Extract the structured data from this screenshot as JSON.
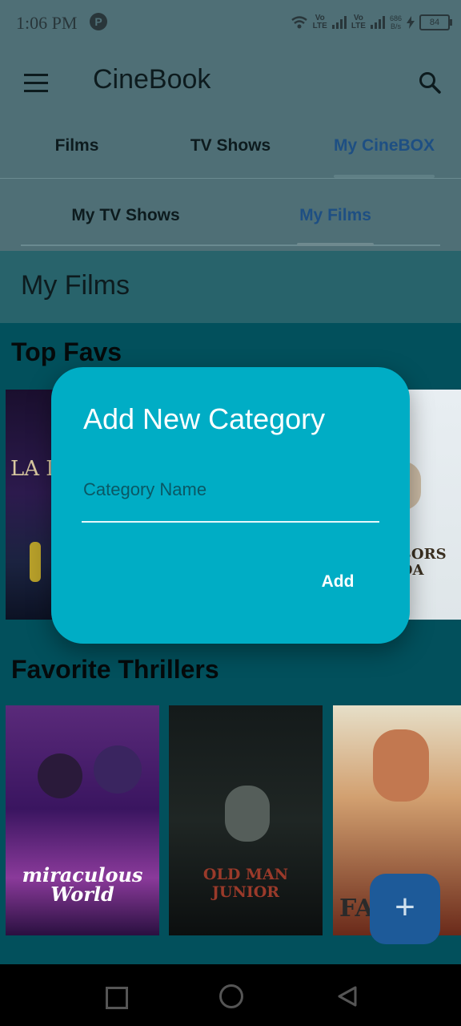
{
  "status_bar": {
    "time": "1:06 PM",
    "notification_icon": "P",
    "volte_1": "Vo\nLTE",
    "volte_2": "Vo\nLTE",
    "data_speed": "686\nB/s",
    "battery": "84"
  },
  "app_bar": {
    "title": "CineBook",
    "menu_icon": "hamburger-icon",
    "search_icon": "search-icon"
  },
  "tabs": [
    {
      "label": "Films",
      "active": false
    },
    {
      "label": "TV Shows",
      "active": false
    },
    {
      "label": "My CineBOX",
      "active": true
    }
  ],
  "subtabs": [
    {
      "label": "My TV Shows",
      "active": false
    },
    {
      "label": "My Films",
      "active": true
    }
  ],
  "section": {
    "title": "My Films"
  },
  "categories": [
    {
      "title": "Top Favs",
      "posters": [
        "LA LA",
        "",
        "GHBORS\nMADA"
      ]
    },
    {
      "title": "Favorite Thrillers",
      "posters": [
        "miraculous\nWorld",
        "OLD MAN JUNIOR",
        "FA A"
      ]
    }
  ],
  "dialog": {
    "title": "Add New Category",
    "input_placeholder": "Category Name",
    "input_value": "",
    "add_label": "Add"
  },
  "fab": {
    "icon": "plus-icon",
    "label": "+"
  },
  "colors": {
    "accent": "#00adc5",
    "active_tab": "#1e4f83",
    "fab": "#1d5a99"
  }
}
